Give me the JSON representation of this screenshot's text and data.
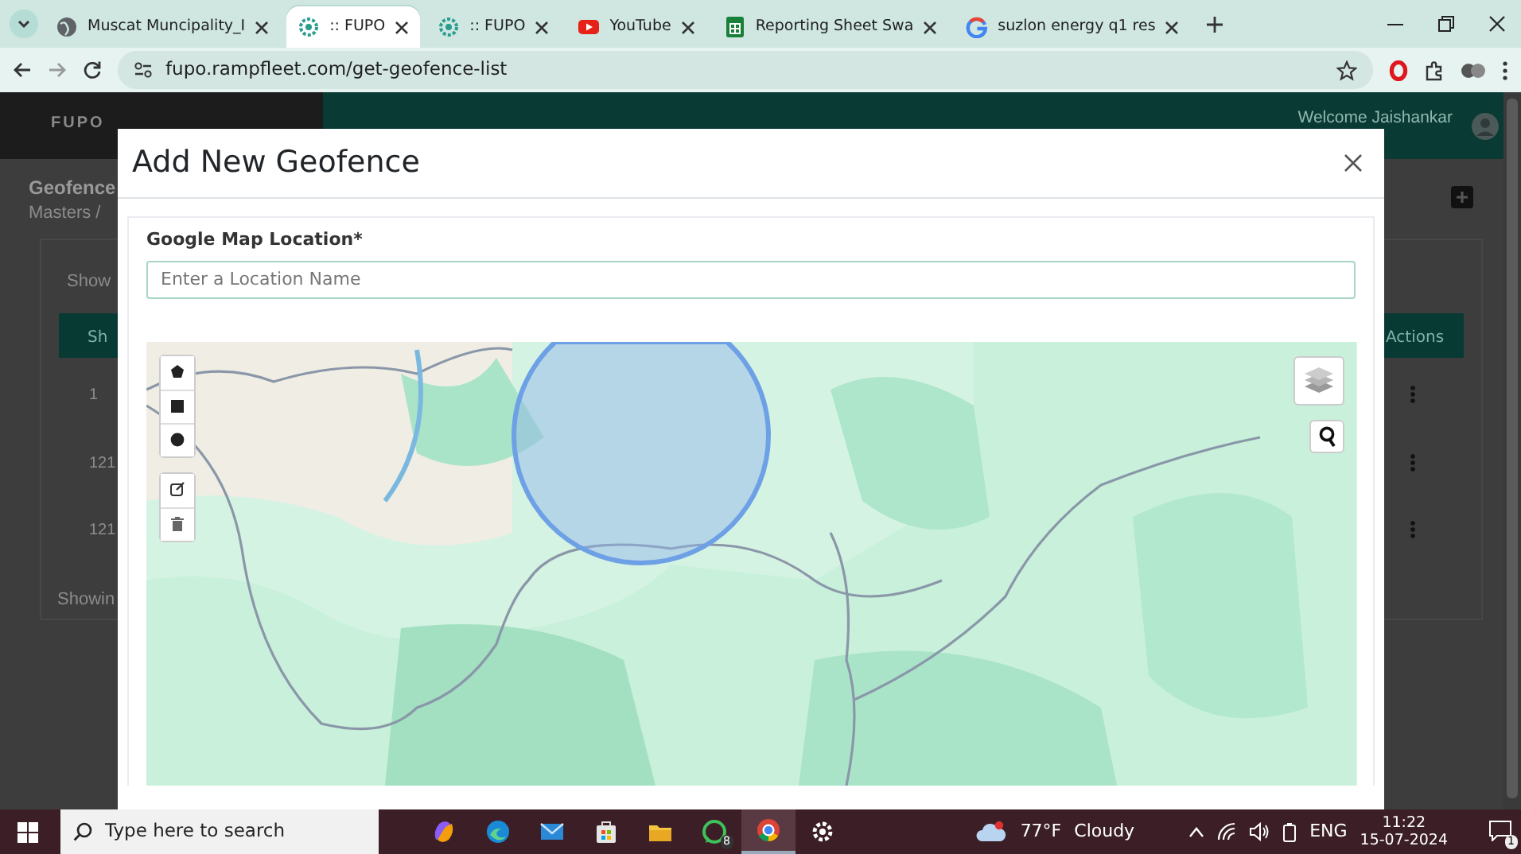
{
  "browser": {
    "tabs": [
      {
        "title": "Muscat Muncipality_I",
        "selected": false
      },
      {
        "title": ":: FUPO",
        "selected": true
      },
      {
        "title": ":: FUPO",
        "selected": false
      },
      {
        "title": "YouTube",
        "selected": false
      },
      {
        "title": "Reporting Sheet Swa",
        "selected": false
      },
      {
        "title": "suzlon energy q1 res",
        "selected": false
      }
    ],
    "url": "fupo.rampfleet.com/get-geofence-list"
  },
  "page": {
    "logo": "FUPO",
    "welcome": "Welcome Jaishankar",
    "title": "Geofence",
    "breadcrumb": "Masters /",
    "show_label": "Show",
    "table": {
      "columns": [
        "Sh",
        "Actions"
      ],
      "rows": [
        [
          "1"
        ],
        [
          "121"
        ],
        [
          "121"
        ]
      ]
    },
    "footer": "Showin"
  },
  "modal": {
    "title": "Add New Geofence",
    "location_field": {
      "label": "Google Map Location*",
      "placeholder": "Enter a Location Name"
    },
    "map": {
      "draw_tools": [
        {
          "kind": "polygon"
        },
        {
          "kind": "rectangle"
        },
        {
          "kind": "circle"
        }
      ],
      "edit_tools": [
        {
          "kind": "edit"
        },
        {
          "kind": "delete"
        }
      ]
    }
  },
  "taskbar": {
    "search_placeholder": "Type here to search",
    "apps": [
      {
        "kind": "copilot",
        "selected": false
      },
      {
        "kind": "edge",
        "selected": false
      },
      {
        "kind": "mail",
        "selected": false
      },
      {
        "kind": "store",
        "selected": false
      },
      {
        "kind": "explorer",
        "selected": false
      },
      {
        "kind": "whatsapp",
        "badge": "8",
        "selected": false
      },
      {
        "kind": "chrome",
        "selected": true
      },
      {
        "kind": "settings",
        "selected": false
      }
    ],
    "weather": {
      "temperature": "77°F",
      "condition": "Cloudy"
    },
    "language": "ENG",
    "time": "11:22",
    "date": "15-07-2024",
    "notifications": "1"
  }
}
